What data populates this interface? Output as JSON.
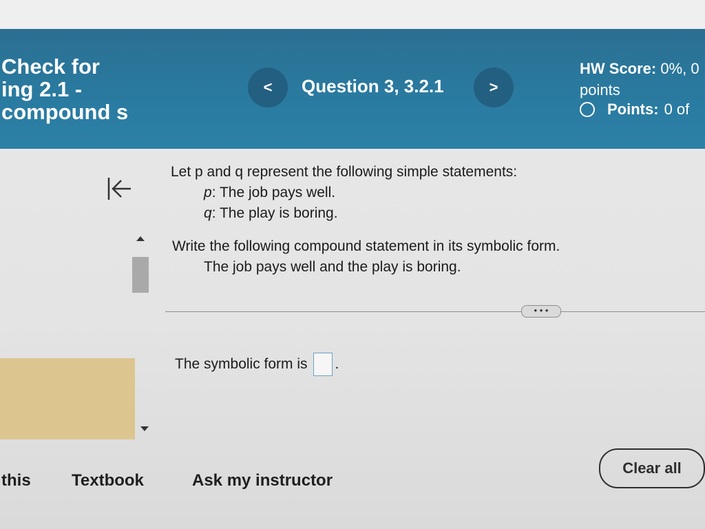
{
  "header": {
    "assignment_title_lines": [
      "Check for",
      "ing 2.1 -",
      "compound s"
    ],
    "prev_label": "<",
    "question_label": "Question 3, 3.2.1",
    "next_label": ">",
    "hw_score_label": "HW Score:",
    "hw_score_value": "0%, 0",
    "hw_score_unit": "points",
    "points_label": "Points:",
    "points_value": "0 of"
  },
  "sidebar": {
    "collapse_icon": "collapse-left-icon"
  },
  "question": {
    "intro": "Let p and q represent the following simple statements:",
    "statements": [
      {
        "var": "p",
        "text": "The job pays well."
      },
      {
        "var": "q",
        "text": "The play is boring."
      }
    ],
    "task": "Write the following compound statement in its symbolic form.",
    "compound_statement": "The job pays well and the play is boring.",
    "more_label": "• • •",
    "answer_prefix": "The symbolic form is",
    "answer_value": "",
    "answer_suffix": "."
  },
  "footer": {
    "links": [
      "this",
      "Textbook",
      "Ask my instructor"
    ],
    "clear_all_label": "Clear all"
  }
}
